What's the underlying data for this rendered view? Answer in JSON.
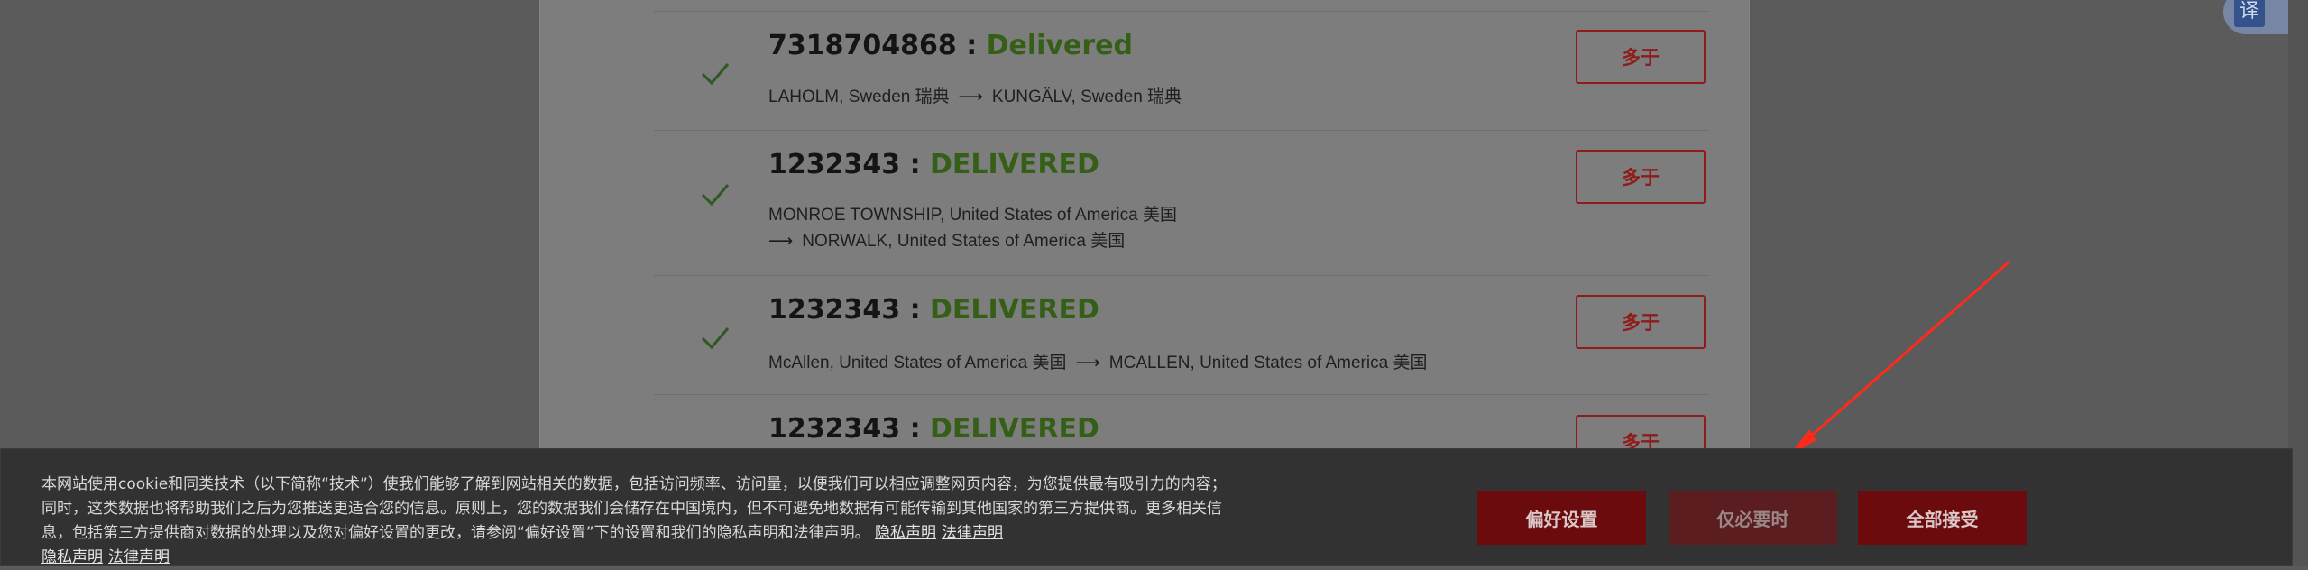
{
  "translate_icon": {
    "glyph": "译"
  },
  "shipments": [
    {
      "tracking_number": "7318704868",
      "separator": " : ",
      "status": "Delivered",
      "route_line1_from": "LAHOLM, Sweden 瑞典",
      "route_line1_to": "KUNGÄLV, Sweden 瑞典",
      "route_line2": "",
      "more_label": "多于"
    },
    {
      "tracking_number": "1232343",
      "separator": " : ",
      "status": "DELIVERED",
      "route_line1_from": "MONROE TOWNSHIP, United States of America 美国",
      "route_line1_to": "",
      "route_line2": "NORWALK, United States of America 美国",
      "more_label": "多于"
    },
    {
      "tracking_number": "1232343",
      "separator": " : ",
      "status": "DELIVERED",
      "route_line1_from": "McAllen, United States of America 美国",
      "route_line1_to": "MCALLEN, United States of America 美国",
      "route_line2": "",
      "more_label": "多于"
    },
    {
      "tracking_number": "1232343",
      "separator": " : ",
      "status": "DELIVERED",
      "route_line1_from": "",
      "route_line1_to": "",
      "route_line2": "",
      "more_label": "多于"
    }
  ],
  "arrow_glyph": "⟶",
  "cookie_banner": {
    "text": "本网站使用cookie和同类技术（以下简称“技术”）使我们能够了解到网站相关的数据，包括访问频率、访问量，以便我们可以相应调整网页内容，为您提供最有吸引力的内容；同时，这类数据也将帮助我们之后为您推送更适合您的信息。原则上，您的数据我们会储存在中国境内，但不可避免地数据有可能传输到其他国家的第三方提供商。更多相关信息，包括第三方提供商对数据的处理以及您对偏好设置的更改，请参阅“偏好设置”下的设置和我们的隐私声明和法律声明。",
    "links_inline": [
      "隐私声明",
      "法律声明"
    ],
    "links_trailing": [
      "隐私声明",
      "法律声明"
    ],
    "buttons": {
      "preferences": "偏好设置",
      "necessary_only": "仅必要时",
      "accept_all": "全部接受"
    }
  },
  "colors": {
    "status_green": "#355f17",
    "brand_red": "#8f1b1b",
    "annotation_red": "#ff2a1a"
  }
}
